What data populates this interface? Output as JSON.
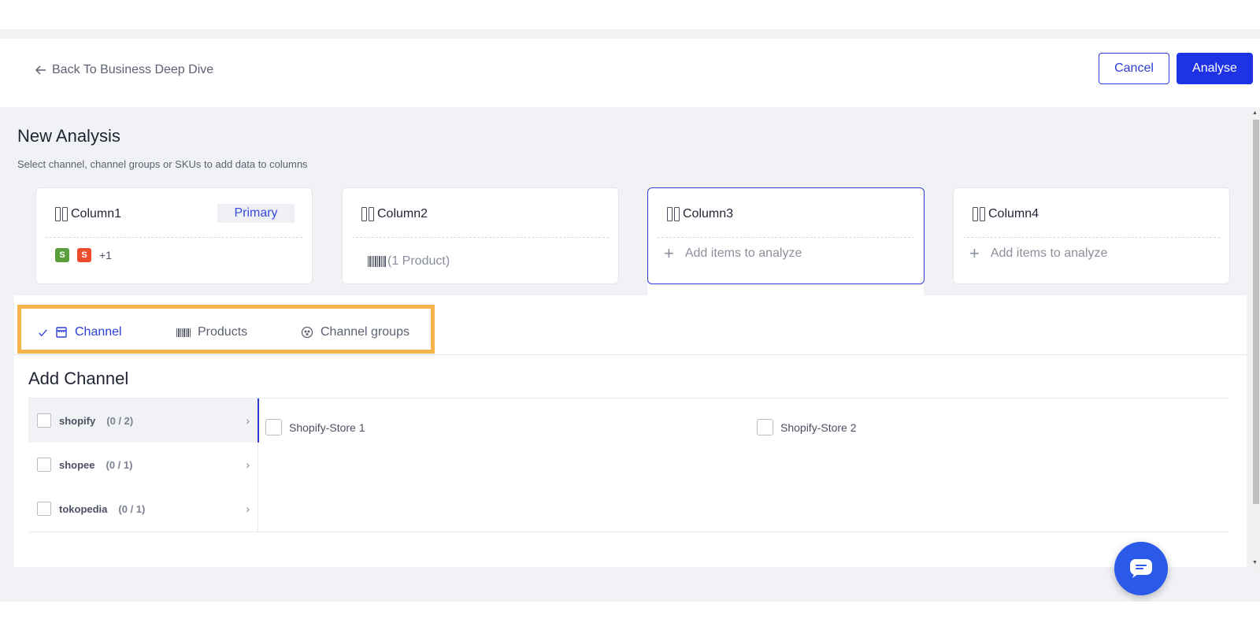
{
  "header": {
    "back_label": "Back To Business Deep Dive",
    "cancel_label": "Cancel",
    "analyse_label": "Analyse"
  },
  "page": {
    "title": "New Analysis",
    "subtitle": "Select channel, channel groups or SKUs to add data to columns"
  },
  "columns": [
    {
      "name": "Column1",
      "badge": "Primary",
      "extra_count": "+1"
    },
    {
      "name": "Column2",
      "summary": "(1 Product)"
    },
    {
      "name": "Column3",
      "placeholder": "Add items to analyze"
    },
    {
      "name": "Column4",
      "placeholder": "Add items to analyze"
    }
  ],
  "tabs": [
    {
      "label": "Channel",
      "icon": "store-icon",
      "active": true
    },
    {
      "label": "Products",
      "icon": "barcode-icon"
    },
    {
      "label": "Channel groups",
      "icon": "group-icon"
    }
  ],
  "panel": {
    "title": "Add Channel",
    "channels": [
      {
        "name": "shopify",
        "count": "(0 / 2)",
        "selected": true
      },
      {
        "name": "shopee",
        "count": "(0 / 1)"
      },
      {
        "name": "tokopedia",
        "count": "(0 / 1)"
      }
    ],
    "stores": [
      "Shopify-Store 1",
      "Shopify-Store 2"
    ]
  },
  "colors": {
    "accent": "#1f33e6",
    "highlight": "#f5b548",
    "chat": "#2b59e8"
  }
}
